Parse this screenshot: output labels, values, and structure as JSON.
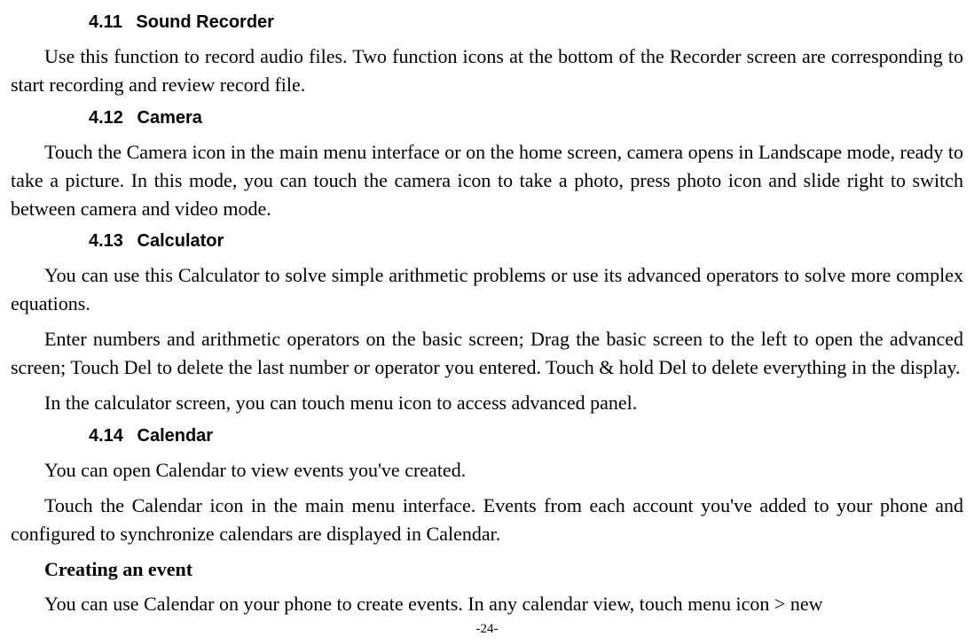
{
  "sections": {
    "s411": {
      "num": "4.11",
      "title": "Sound Recorder",
      "p1": "Use this function to record audio files. Two function icons at the bottom of the Recorder screen are corresponding to start recording and review record file."
    },
    "s412": {
      "num": "4.12",
      "title": "Camera",
      "p1": "Touch the Camera icon in the main menu interface or on the home screen, camera opens in Landscape mode, ready to take a picture. In this mode, you can touch the camera icon to take a photo, press photo icon and slide right to switch between camera and video mode."
    },
    "s413": {
      "num": "4.13",
      "title": "Calculator",
      "p1": "You can use this Calculator to solve simple arithmetic problems or use its advanced operators to solve more complex equations.",
      "p2": "Enter numbers and arithmetic operators on the basic screen; Drag the basic screen to the left to open the advanced screen; Touch Del to delete the last number or operator you entered. Touch & hold Del to delete everything in the display.",
      "p3": "In the calculator screen, you can touch menu icon to access advanced panel."
    },
    "s414": {
      "num": "4.14",
      "title": "Calendar",
      "p1": "You can open Calendar to view events you've created.",
      "p2": "Touch the Calendar icon in the main menu interface. Events from each account you've added to your phone and configured to synchronize calendars are displayed in Calendar.",
      "sub1": "Creating an event",
      "p3": "You can use Calendar on your phone to create events. In any calendar view, touch menu icon > new"
    }
  },
  "pageNumber": "-24-"
}
